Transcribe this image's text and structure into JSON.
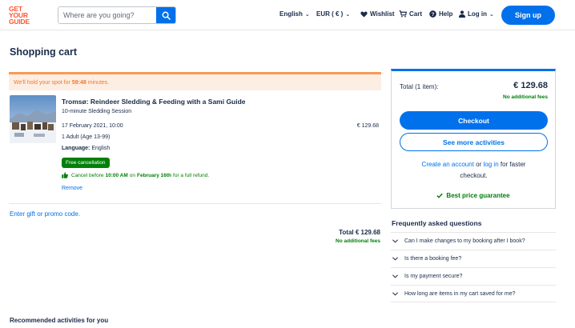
{
  "header": {
    "logo_lines": [
      "GET",
      "YOUR",
      "GUIDE"
    ],
    "search_placeholder": "Where are you going?",
    "language": "English",
    "currency": "EUR ( € )",
    "wishlist": "Wishlist",
    "cart": "Cart",
    "help": "Help",
    "login": "Log in",
    "signup": "Sign up"
  },
  "page": {
    "title": "Shopping cart",
    "hold_text_before": "We'll hold your spot for",
    "hold_time": "59:48",
    "hold_text_after": "minutes."
  },
  "activity": {
    "title": "Tromsø: Reindeer Sledding & Feeding with a Sami Guide",
    "option": "10-minute Sledding Session",
    "date": "17 February 2021, 10:00",
    "price": "€ 129.68",
    "participants": "1 Adult (Age 13-99)",
    "language_label": "Language:",
    "language_value": "English",
    "badge": "Free cancellation",
    "cancel_before": "Cancel before",
    "cancel_time": "10:00 AM",
    "cancel_on": "on",
    "cancel_date": "February 16th",
    "cancel_after": "for a full refund.",
    "remove": "Remove"
  },
  "cart": {
    "promo": "Enter gift or promo code.",
    "total_label": "Total",
    "total_value": "€ 129.68",
    "no_fees": "No additional fees",
    "recommended": "Recommended activities for you"
  },
  "summary": {
    "label": "Total (1 item):",
    "total": "€ 129.68",
    "no_fees": "No additional fees",
    "checkout": "Checkout",
    "see_more": "See more activities",
    "account_link": "Create an account",
    "or": "or",
    "login_link": "log in",
    "for_faster": "for faster",
    "checkout_word": "checkout.",
    "best_price": "Best price guarantee"
  },
  "faq": {
    "title": "Frequently asked questions",
    "items": [
      "Can I make changes to my booking after I book?",
      "Is there a booking fee?",
      "Is my payment secure?",
      "How long are items in my cart saved for me?"
    ]
  },
  "colors": {
    "brand": "#ff5533",
    "primary": "#0071eb",
    "success": "#008009",
    "warning": "#f0772c",
    "text": "#1a2b49"
  },
  "icons": [
    "search-icon",
    "heart-icon",
    "cart-icon",
    "help-icon",
    "user-icon",
    "thumbs-up-icon",
    "check-icon",
    "chevron-down-icon"
  ]
}
